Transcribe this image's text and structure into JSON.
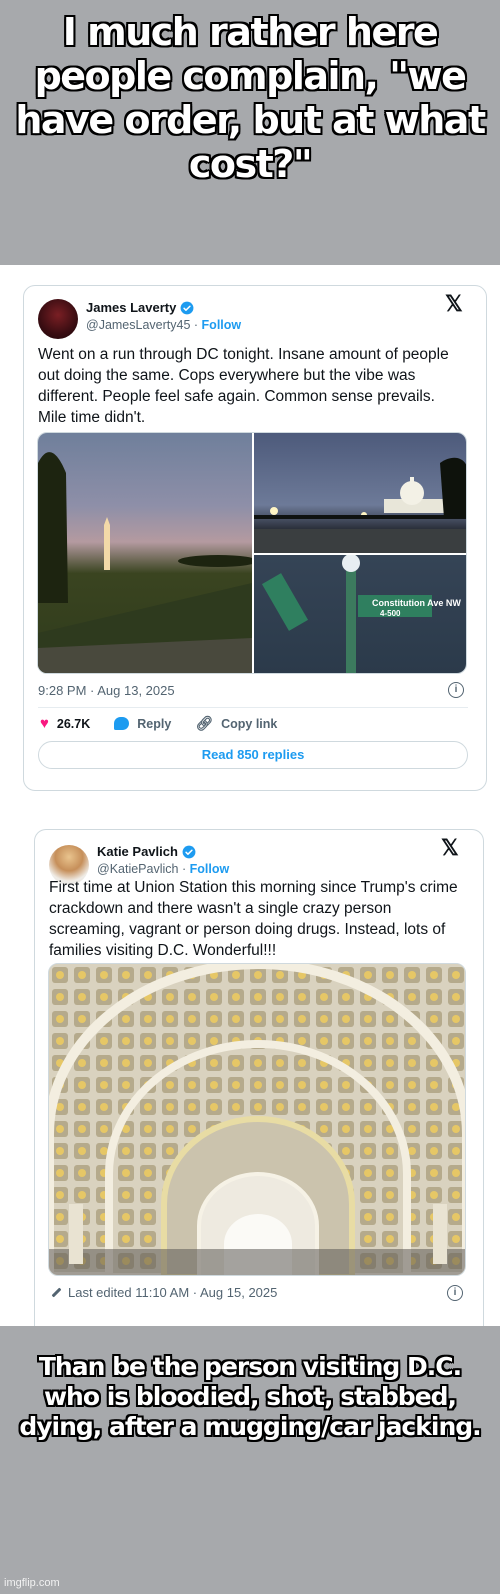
{
  "meme": {
    "top_text": "I much rather here people complain, \"we have order, but at what cost?\"",
    "bottom_text": "Than be the person visiting D.C. who is bloodied, shot, stabbed, dying, after a mugging/car jacking.",
    "watermark": "imgflip.com"
  },
  "tweet1": {
    "name": "James Laverty",
    "handle": "@JamesLaverty45",
    "separator": "·",
    "follow_label": "Follow",
    "text": "Went on a run through DC tonight.  Insane amount of people out doing the same.  Cops everywhere but the vibe was different.  People feel safe again.  Common sense prevails.  Mile time didn't.",
    "images": [
      "Washington Monument at dusk over the National Mall",
      "U.S. Capitol at night",
      "Constitution Ave street sign 4-500"
    ],
    "street_sign": "Constitution Ave NW",
    "street_number": "4-500",
    "timestamp": "9:28 PM · Aug 13, 2025",
    "likes": "26.7K",
    "reply_label": "Reply",
    "copy_link_label": "Copy link",
    "read_replies_label": "Read 850 replies",
    "icons": {
      "like": "heart-icon",
      "reply": "speech-bubble-icon",
      "copy": "link-icon",
      "x": "x-logo-icon",
      "info": "info-icon"
    }
  },
  "tweet2": {
    "name": "Katie Pavlich",
    "handle": "@KatiePavlich",
    "separator": "·",
    "follow_label": "Follow",
    "text": "First time at Union Station this morning since Trump's crime crackdown and there wasn't a single crazy person screaming, vagrant or person doing drugs. Instead, lots of families visiting D.C. Wonderful!!!",
    "image": "Union Station coffered arched ceiling",
    "edited": "Last edited 11:10 AM · Aug 15, 2025",
    "icons": {
      "x": "x-logo-icon",
      "info": "info-icon",
      "edit": "pencil-icon"
    }
  },
  "colors": {
    "meme_bg": "#a7a9ac",
    "accent": "#1d9bf0",
    "like": "#f91880"
  }
}
